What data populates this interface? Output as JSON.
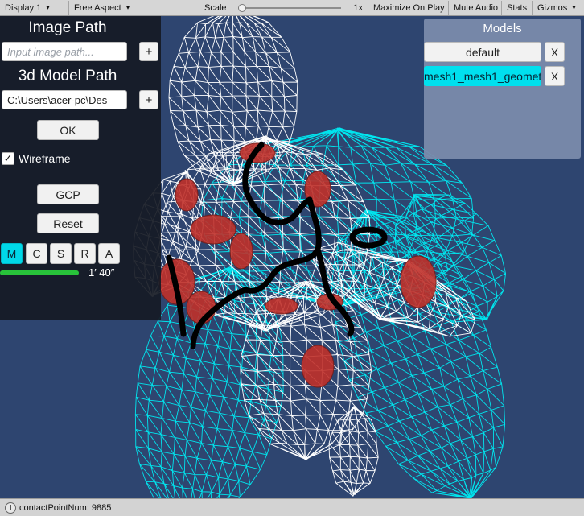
{
  "toolbar": {
    "display": "Display 1",
    "aspect": "Free Aspect",
    "scale_label": "Scale",
    "scale_value": "1x",
    "scale_level": 0,
    "maximize": "Maximize On Play",
    "mute": "Mute Audio",
    "stats": "Stats",
    "gizmos": "Gizmos"
  },
  "panel": {
    "image_path_heading": "Image Path",
    "image_path_placeholder": "Input image path...",
    "add_label": "+",
    "model_path_heading": "3d Model Path",
    "model_path_value": "C:\\Users\\acer-pc\\Des",
    "ok_label": "OK",
    "wireframe_label": "Wireframe",
    "wireframe_checked": true,
    "gcp_label": "GCP",
    "reset_label": "Reset",
    "modes": [
      "M",
      "C",
      "S",
      "R",
      "A"
    ],
    "active_mode": "M",
    "progress_fraction": 1.0,
    "timer": "1′  40″"
  },
  "models_panel": {
    "title": "Models",
    "items": [
      {
        "label": "default",
        "remove": "X",
        "selected": false
      },
      {
        "label": "mesh1_mesh1_geomet",
        "remove": "X",
        "selected": true
      }
    ]
  },
  "status": {
    "text": "contactPointNum:  9885"
  },
  "colors": {
    "background": "#2e4570",
    "mesh_white": "#ffffff",
    "mesh_cyan": "#00e5ee",
    "highlight_red": "#c0302a",
    "stroke_black": "#000000",
    "progress_green": "#28c23a"
  },
  "icons": {
    "wireframe_check": "checkmark-icon",
    "status": "info-icon"
  }
}
